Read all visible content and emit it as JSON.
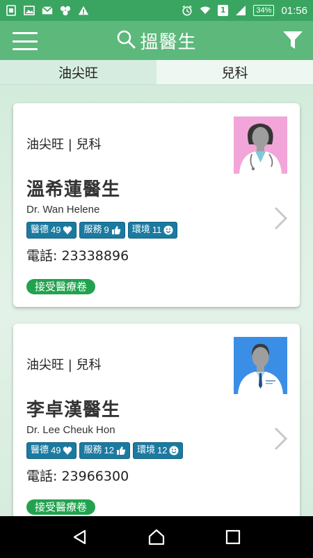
{
  "status_bar": {
    "time": "01:56",
    "battery": "34%",
    "sim": "1",
    "icons": [
      "notification-icon",
      "image-icon",
      "gmail-icon",
      "app-icon",
      "warning-icon",
      "alarm-icon",
      "wifi-icon",
      "signal-icon",
      "battery-icon"
    ]
  },
  "app_bar": {
    "title": "搵醫生",
    "icons": [
      "menu-icon",
      "search-icon",
      "filter-icon"
    ]
  },
  "tabs": [
    {
      "label": "油尖旺"
    },
    {
      "label": "兒科"
    }
  ],
  "doctors": [
    {
      "district": "油尖旺",
      "separator": "|",
      "specialty": "兒科",
      "name_zh": "溫希蓮醫生",
      "name_en": "Dr. Wan Helene",
      "badges": [
        {
          "label": "醫德",
          "value": "49",
          "icon": "heart-icon"
        },
        {
          "label": "服務",
          "value": "9",
          "icon": "thumbs-up-icon"
        },
        {
          "label": "環境",
          "value": "11",
          "icon": "smile-icon"
        }
      ],
      "phone_label": "電話:",
      "phone": "23338896",
      "voucher": "接受醫療卷",
      "photo_bg": "#f2a5d8",
      "photo_gender": "female"
    },
    {
      "district": "油尖旺",
      "separator": "|",
      "specialty": "兒科",
      "name_zh": "李卓漢醫生",
      "name_en": "Dr. Lee Cheuk Hon",
      "badges": [
        {
          "label": "醫德",
          "value": "49",
          "icon": "heart-icon"
        },
        {
          "label": "服務",
          "value": "12",
          "icon": "thumbs-up-icon"
        },
        {
          "label": "環境",
          "value": "12",
          "icon": "smile-icon"
        }
      ],
      "phone_label": "電話:",
      "phone": "23966300",
      "voucher": "接受醫療卷",
      "photo_bg": "#3b8ee6",
      "photo_gender": "male"
    }
  ],
  "colors": {
    "status_bar": "#3aa561",
    "app_bar": "#5cb87b",
    "badge": "#1c7aa0",
    "voucher": "#22a24e"
  }
}
